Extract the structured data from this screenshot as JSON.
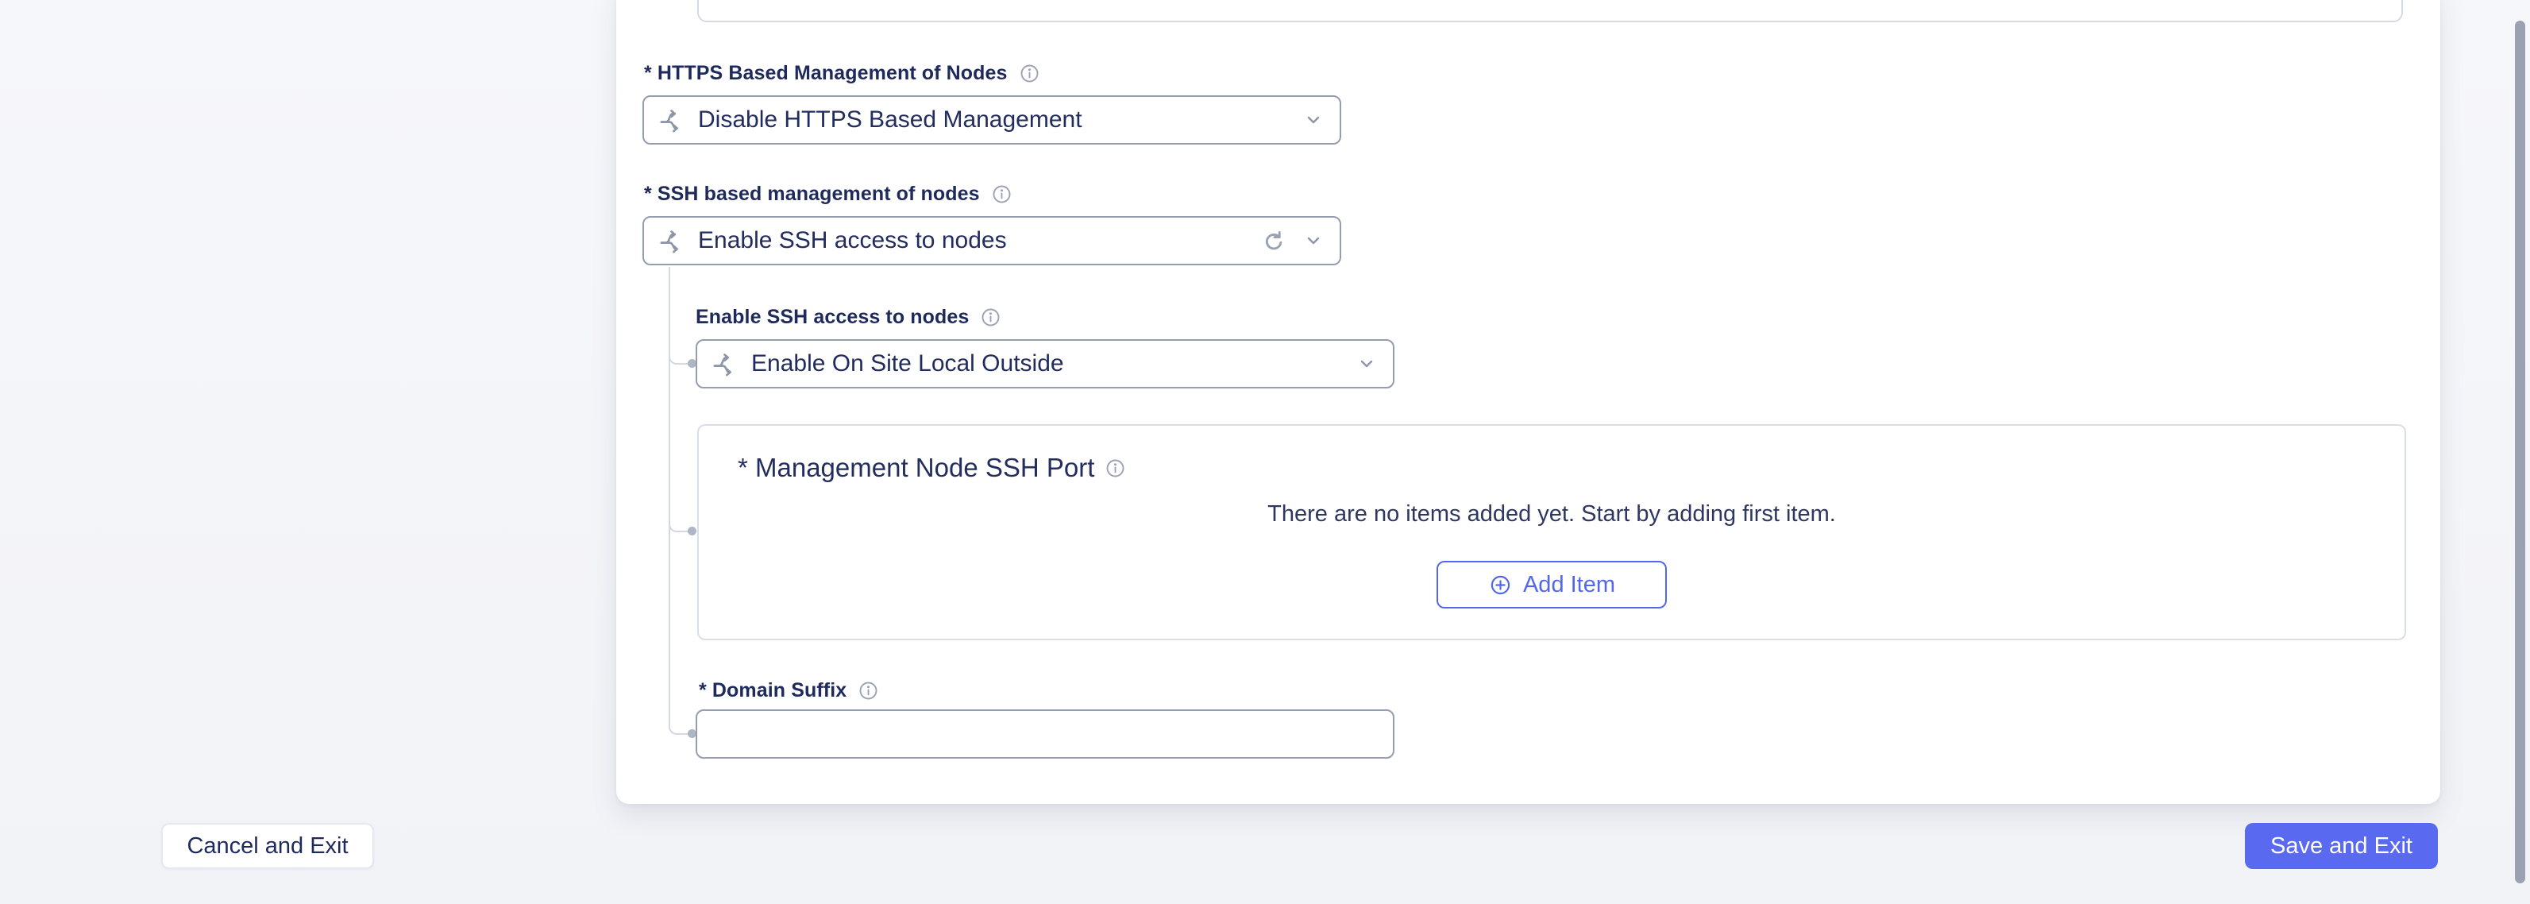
{
  "form_panel": {
    "top_field": {
      "value": ""
    },
    "https_field": {
      "label": "* HTTPS Based Management of Nodes",
      "value": "Disable HTTPS Based Management"
    },
    "ssh_field": {
      "label": "* SSH based management of nodes",
      "value": "Enable SSH access to nodes"
    },
    "ssh_nested_field": {
      "label": "Enable SSH access to nodes",
      "value": "Enable On Site Local Outside"
    },
    "ssh_port_list": {
      "title": "* Management Node SSH Port",
      "empty_message": "There are no items added yet. Start by adding first item.",
      "add_item_label": "Add Item"
    },
    "domain_suffix_field": {
      "label": "* Domain Suffix",
      "value": "",
      "placeholder": ""
    }
  },
  "footer": {
    "cancel_label": "Cancel and Exit",
    "save_label": "Save and Exit"
  },
  "icons": {
    "branch": "branch-icon",
    "chevron_down": "chevron-down-icon",
    "reload": "reload-icon",
    "info": "info-icon",
    "plus_circle": "plus-circle-icon"
  },
  "colors": {
    "accent_blue": "#5367ec",
    "save_button_bg": "#5a6af0",
    "label_navy": "#1f2a5c",
    "control_border": "#959daf",
    "panel_border": "#dadee7",
    "muted_icon": "#8d95a9",
    "tree_line": "#d4d8e1",
    "scrollbar_thumb": "#9aa1b0",
    "page_background": "#f4f5f8"
  }
}
